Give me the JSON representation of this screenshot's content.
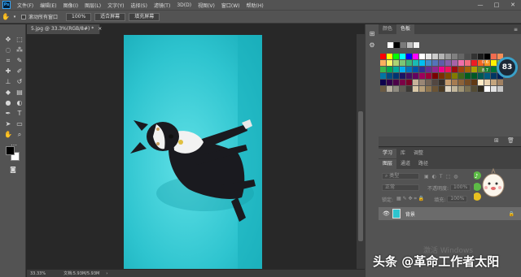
{
  "menubar": {
    "logo": "Ps",
    "items": [
      "文件(F)",
      "编辑(E)",
      "图像(I)",
      "图层(L)",
      "文字(Y)",
      "选择(S)",
      "滤镜(T)",
      "3D(D)",
      "视图(V)",
      "窗口(W)",
      "帮助(H)"
    ],
    "window_controls": [
      "—",
      "□",
      "✕"
    ]
  },
  "options_bar": {
    "scroll_all_windows": "滚动所有窗口",
    "zoom": "100%",
    "fit_screen": "适合屏幕",
    "fill_screen": "填充屏幕"
  },
  "document": {
    "tab_title": "5.jpg @ 33.3%(RGB/8#) *",
    "tab_close": "×",
    "zoom_readout": "33.33%",
    "doc_size": "文档:5.93M/5.93M"
  },
  "swatch_panel": {
    "tabs": [
      "颜色",
      "色板"
    ],
    "active_tab": "色板"
  },
  "perf_widget": {
    "score": "83",
    "stat_1": "0.6",
    "stat_2": "8.7"
  },
  "learn_panel": {
    "tabs": [
      "学习",
      "库",
      "调整"
    ]
  },
  "layers_panel": {
    "tabs": [
      "图层",
      "通道",
      "路径"
    ],
    "kind_filter": "类型",
    "blend_mode": "正常",
    "opacity_label": "不透明度:",
    "opacity_value": "100%",
    "lock_label": "锁定:",
    "fill_label": "填充:",
    "fill_value": "100%",
    "layer_name": "背景"
  },
  "overlay": {
    "os_watermark": "激活 Windows",
    "credit": "头条 @革命工作者太阳"
  },
  "colors": {
    "app_bg": "#535353",
    "canvas_bg": "#282828",
    "photo_bg": "#2ec4cf",
    "accent": "#31a8ff"
  },
  "icons": {
    "toolbar": [
      "move-icon",
      "marquee-icon",
      "lasso-icon",
      "magic-wand-icon",
      "crop-icon",
      "eyedropper-icon",
      "healing-brush-icon",
      "brush-icon",
      "clone-stamp-icon",
      "history-brush-icon",
      "eraser-icon",
      "gradient-icon",
      "blur-icon",
      "dodge-icon",
      "pen-icon",
      "type-icon",
      "path-select-icon",
      "rectangle-icon",
      "hand-icon",
      "zoom-icon"
    ]
  }
}
